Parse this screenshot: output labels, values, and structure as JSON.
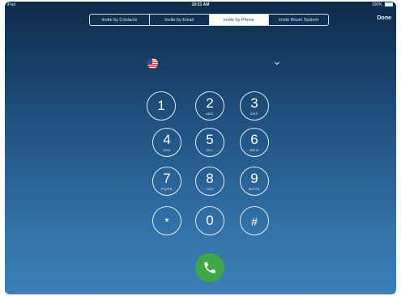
{
  "statusbar": {
    "device": "iPad",
    "time": "10:51 AM",
    "battery": "100%"
  },
  "segments": [
    {
      "label": "Invite by Contacts",
      "active": false
    },
    {
      "label": "Invite by Email",
      "active": false
    },
    {
      "label": "Invite by Phone",
      "active": true
    },
    {
      "label": "Invite Room System",
      "active": false
    }
  ],
  "done_label": "Done",
  "country": {
    "icon": "us-flag-icon",
    "dropdown_icon": "chevron-down-icon"
  },
  "keypad": {
    "k1": {
      "digit": "1",
      "letters": ""
    },
    "k2": {
      "digit": "2",
      "letters": "ABC"
    },
    "k3": {
      "digit": "3",
      "letters": "DEF"
    },
    "k4": {
      "digit": "4",
      "letters": "GHI"
    },
    "k5": {
      "digit": "5",
      "letters": "JKL"
    },
    "k6": {
      "digit": "6",
      "letters": "MNO"
    },
    "k7": {
      "digit": "7",
      "letters": "PQRS"
    },
    "k8": {
      "digit": "8",
      "letters": "TUV"
    },
    "k9": {
      "digit": "9",
      "letters": "WXYZ"
    },
    "kstar": {
      "digit": "*",
      "letters": ""
    },
    "k0": {
      "digit": "0",
      "letters": ""
    },
    "khash": {
      "digit": "#",
      "letters": ""
    }
  },
  "call_button": {
    "icon": "phone-icon",
    "color": "#3fa64a"
  }
}
